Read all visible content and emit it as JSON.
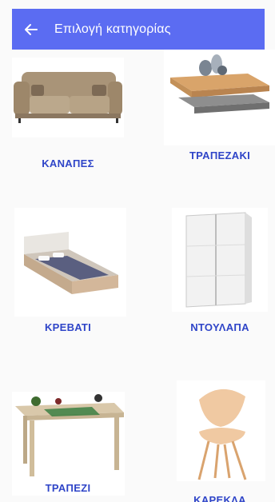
{
  "appbar": {
    "title": "Επιλογή κατηγορίας",
    "back_icon": "arrow-back-icon"
  },
  "categories": [
    {
      "label": "ΚΑΝΑΠΕΣ",
      "icon": "sofa-image"
    },
    {
      "label": "ΤΡΑΠΕΖΑΚΙ",
      "icon": "coffee-table-image"
    },
    {
      "label": "ΚΡΕΒΑΤΙ",
      "icon": "bed-image"
    },
    {
      "label": "ΝΤΟΥΛΑΠΑ",
      "icon": "wardrobe-image"
    },
    {
      "label": "ΤΡΑΠΕΖΙ",
      "icon": "dining-table-image"
    },
    {
      "label": "ΚΑΡΕΚΛΑ",
      "icon": "chair-image"
    }
  ],
  "colors": {
    "appbar": "#5b6cf2",
    "label": "#2f45c8",
    "background": "#fafafa"
  }
}
